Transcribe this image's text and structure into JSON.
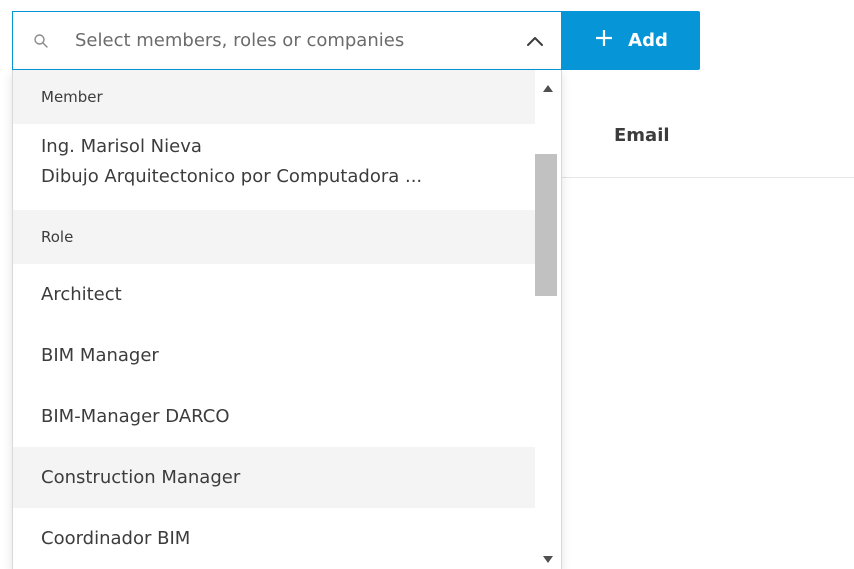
{
  "search": {
    "placeholder": "Select members, roles or companies",
    "value": ""
  },
  "add_button": {
    "label": "Add"
  },
  "table": {
    "email_header": "Email"
  },
  "dropdown": {
    "member_group": {
      "label": "Member",
      "items": [
        {
          "name": "Ing. Marisol Nieva",
          "company": "Dibujo Arquitectonico por Computadora ..."
        }
      ]
    },
    "role_group": {
      "label": "Role",
      "items": [
        {
          "label": "Architect"
        },
        {
          "label": "BIM Manager"
        },
        {
          "label": "BIM-Manager DARCO"
        },
        {
          "label": "Construction Manager"
        },
        {
          "label": "Coordinador BIM"
        }
      ]
    }
  },
  "colors": {
    "accent": "#0696d7",
    "group_header_bg": "#f4f4f4",
    "hover_bg": "#f4f4f4",
    "text": "#3c3c3c",
    "scroll_thumb": "#c1c1c1"
  },
  "icons": {
    "search": "search-icon",
    "collapse": "chevron-up-icon",
    "add": "plus-icon",
    "scroll_up": "triangle-up-icon",
    "scroll_down": "triangle-down-icon"
  }
}
